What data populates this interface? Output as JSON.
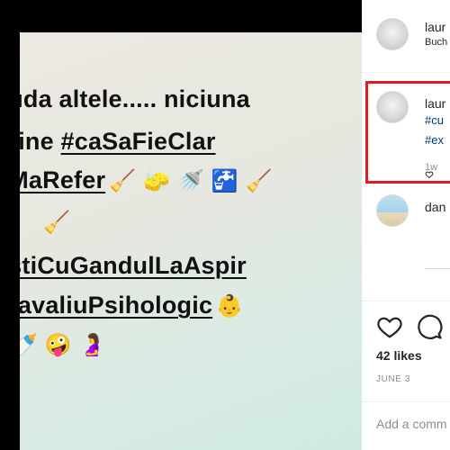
{
  "post": {
    "lines": [
      {
        "parts": [
          {
            "text": "auda altele..... niciuna",
            "u": false
          }
        ],
        "emoji": ""
      },
      {
        "parts": [
          {
            "text": " mine ",
            "u": false
          },
          {
            "text": "#caSaFieClar",
            "u": true
          }
        ],
        "emoji": ""
      },
      {
        "parts": [
          {
            "text": "eMaRefer",
            "u": true
          }
        ],
        "emoji": "🧹 🧽 🚿 🚰 🧹"
      },
      {
        "parts": [],
        "emoji": "🧹"
      },
      {
        "parts": [
          {
            "text": "estiCuGandulLaAspir",
            "u": true
          }
        ],
        "emoji": ""
      },
      {
        "parts": [
          {
            "text": "TravaliuPsihologic",
            "u": true
          }
        ],
        "emoji": "👶"
      },
      {
        "parts": [],
        "emoji": "🍼 🤪 🤰"
      }
    ]
  },
  "panel": {
    "header": {
      "username": "laur",
      "location": "Buch"
    },
    "comments": [
      {
        "username": "laur",
        "hashtags": [
          "#cu",
          "#ex"
        ],
        "time": "1w"
      },
      {
        "username": "dan",
        "hashtags": [],
        "time": ""
      }
    ],
    "likes": "42 likes",
    "date": "JUNE 3",
    "add_comment_placeholder": "Add a comm",
    "icons": {
      "like": "heart-icon",
      "comment": "comment-icon",
      "reply": "reply-icon"
    }
  }
}
